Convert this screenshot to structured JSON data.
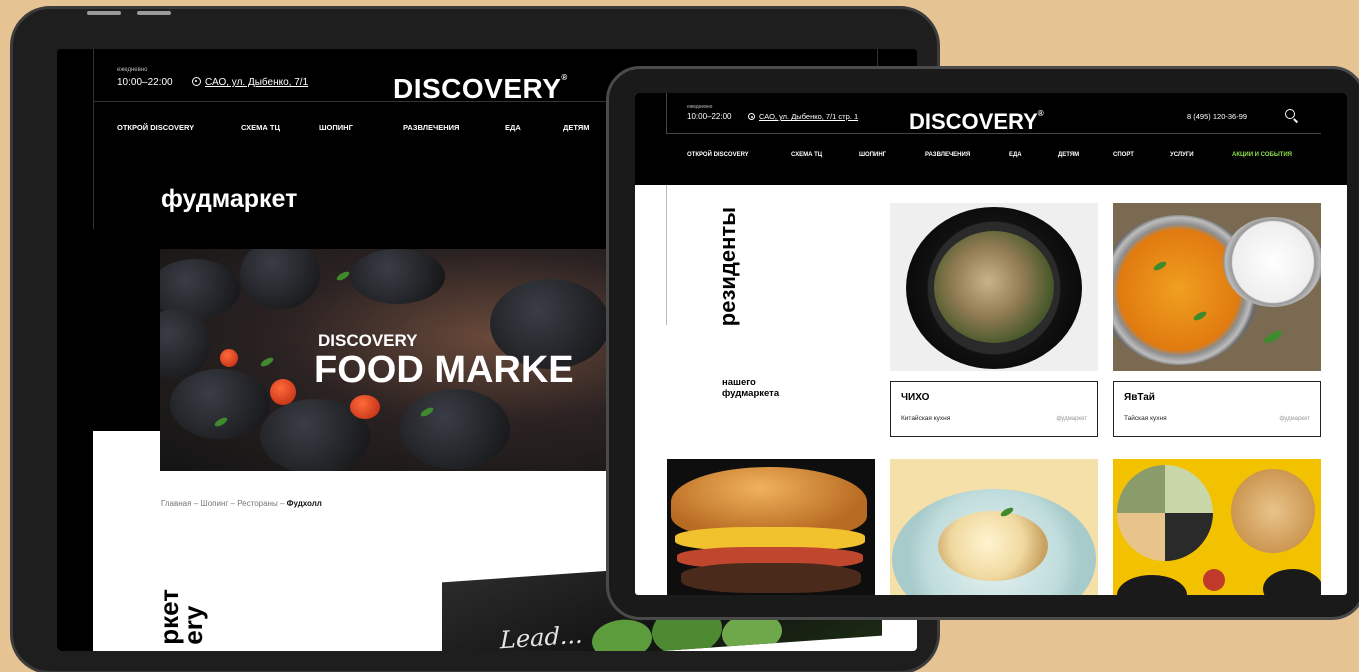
{
  "back": {
    "hours_label": "ежедневно",
    "hours": "10:00–22:00",
    "address": "САО, ул. Дыбенко, 7/1",
    "logo": "DISCOVERY",
    "logo_mark": "®",
    "nav": [
      "ОТКРОЙ DISCOVERY",
      "СХЕМА ТЦ",
      "ШОПИНГ",
      "РАЗВЛЕЧЕНИЯ",
      "ЕДА",
      "ДЕТЯМ"
    ],
    "page_title": "фудмаркет",
    "hero_brand": "DISCOVERY",
    "hero_title": "FOOD MARKE",
    "breadcrumbs": [
      "Главная",
      "Шопинг",
      "Рестораны"
    ],
    "breadcrumb_sep": " – ",
    "breadcrumb_current": "Фудхолл",
    "side_text_1": "ркет",
    "side_text_2": "ery",
    "photo_script": "Lead..."
  },
  "front": {
    "hours_label": "ежедневно",
    "hours": "10:00–22:00",
    "address": "САО, ул. Дыбенко, 7/1 стр. 1",
    "logo": "DISCOVERY",
    "logo_mark": "®",
    "phone": "8 (495) 120-36-99",
    "nav": [
      "ОТКРОЙ DISCOVERY",
      "СХЕМА ТЦ",
      "ШОПИНГ",
      "РАЗВЛЕЧЕНИЯ",
      "ЕДА",
      "ДЕТЯМ",
      "СПОРТ",
      "УСЛУГИ",
      "АКЦИИ И СОБЫТИЯ"
    ],
    "accent_color": "#8fe04e",
    "section_title": "резиденты",
    "section_subtitle": "нашего фудмаркета",
    "cards": [
      {
        "name": "ЧИХО",
        "cuisine": "Китайская кухня",
        "tag": "фудмаркет"
      },
      {
        "name": "ЯвТай",
        "cuisine": "Тайская кухня",
        "tag": "фудмаркет"
      }
    ]
  },
  "icons": [
    "pin-icon",
    "search-icon"
  ]
}
